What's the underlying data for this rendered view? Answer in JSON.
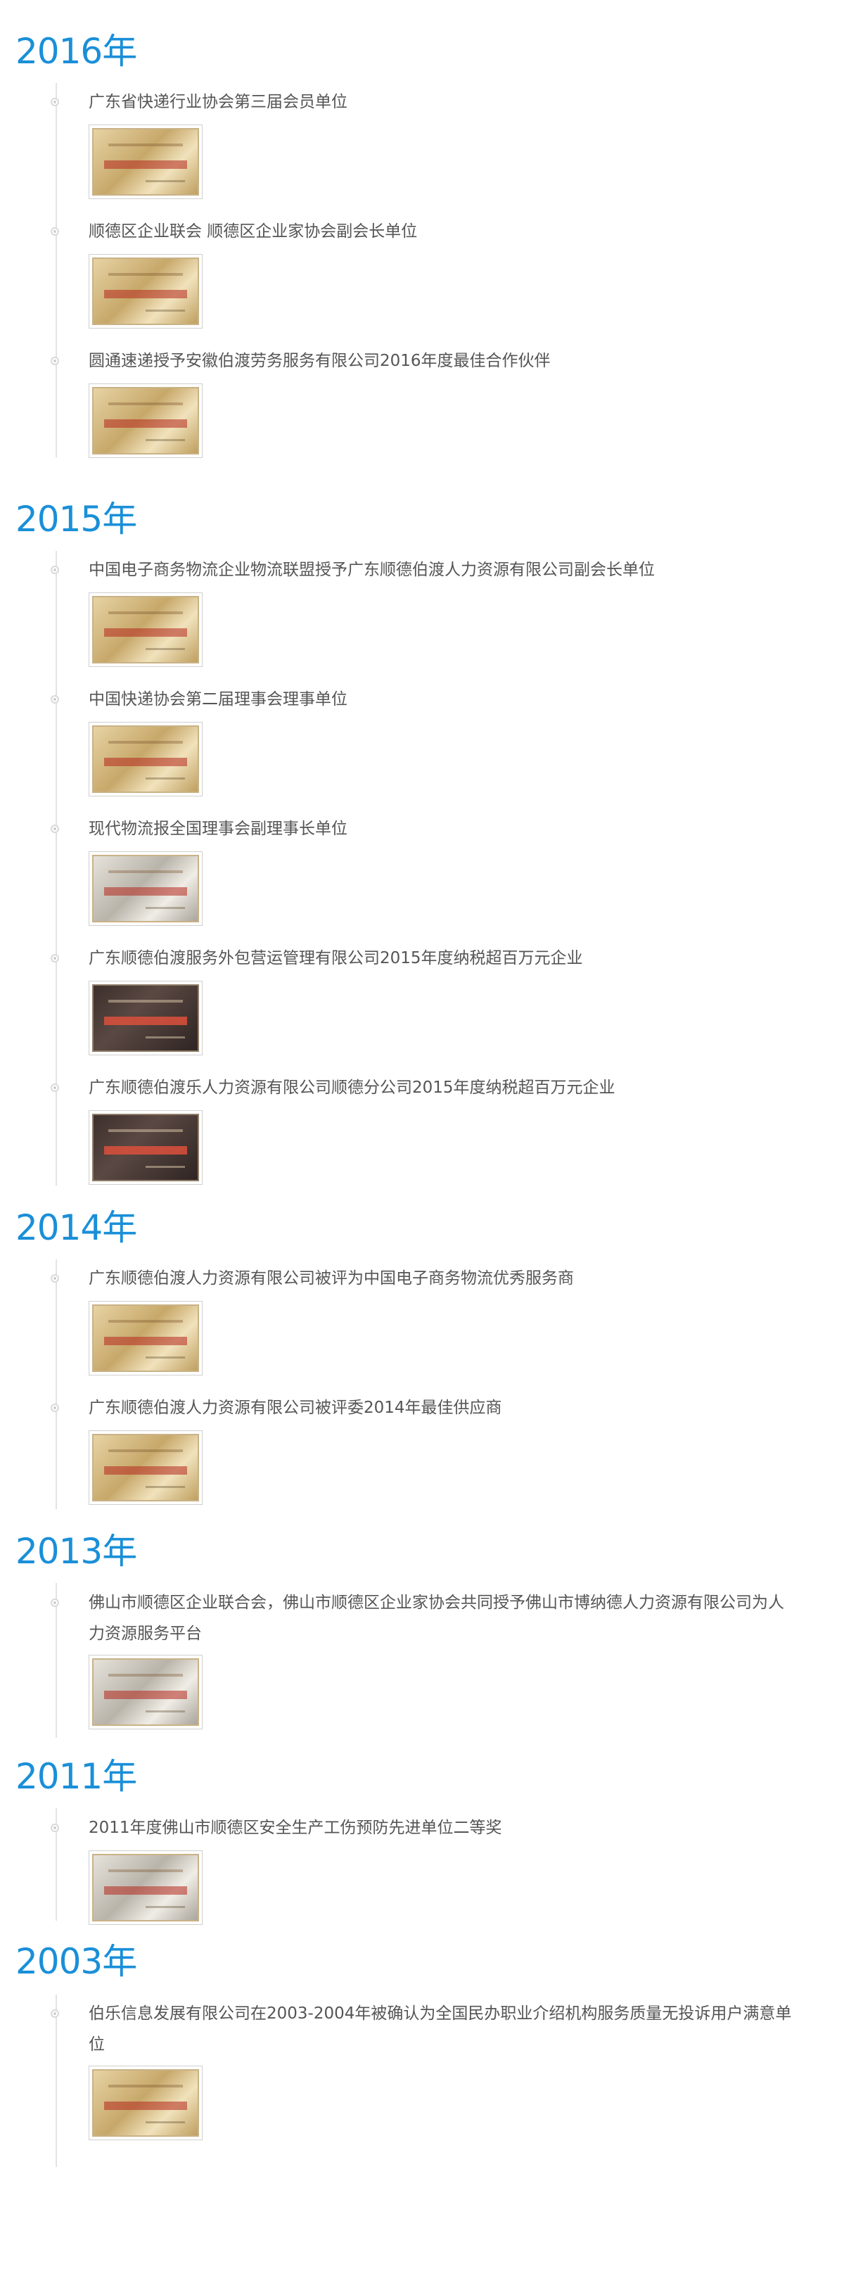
{
  "timeline": [
    {
      "year": "2016年",
      "items": [
        {
          "title": "广东省快递行业协会第三届会员单位",
          "image": "certificate-image",
          "style": "gold"
        },
        {
          "title": "顺德区企业联会  顺德区企业家协会副会长单位",
          "image": "certificate-image",
          "style": "gold"
        },
        {
          "title": "圆通速递授予安徽伯渡劳务服务有限公司2016年度最佳合作伙伴",
          "image": "certificate-image",
          "style": "gold"
        }
      ]
    },
    {
      "year": "2015年",
      "items": [
        {
          "title": "中国电子商务物流企业物流联盟授予广东顺德伯渡人力资源有限公司副会长单位",
          "image": "certificate-image",
          "style": "gold"
        },
        {
          "title": "中国快递协会第二届理事会理事单位",
          "image": "certificate-image",
          "style": "gold"
        },
        {
          "title": "现代物流报全国理事会副理事长单位",
          "image": "certificate-image",
          "style": "silver"
        },
        {
          "title": "广东顺德伯渡服务外包营运管理有限公司2015年度纳税超百万元企业",
          "image": "certificate-image",
          "style": "dark"
        },
        {
          "title": "广东顺德伯渡乐人力资源有限公司顺德分公司2015年度纳税超百万元企业",
          "image": "certificate-image",
          "style": "dark"
        }
      ]
    },
    {
      "year": "2014年",
      "items": [
        {
          "title": "广东顺德伯渡人力资源有限公司被评为中国电子商务物流优秀服务商",
          "image": "certificate-image",
          "style": "gold"
        },
        {
          "title": "广东顺德伯渡人力资源有限公司被评委2014年最佳供应商",
          "image": "certificate-image",
          "style": "gold"
        }
      ]
    },
    {
      "year": "2013年",
      "items": [
        {
          "title": "佛山市顺德区企业联合会，佛山市顺德区企业家协会共同授予佛山市博纳德人力资源有限公司为人力资源服务平台",
          "image": "certificate-image",
          "style": "silver"
        }
      ]
    },
    {
      "year": "2011年",
      "items": [
        {
          "title": "2011年度佛山市顺德区安全生产工伤预防先进单位二等奖",
          "image": "certificate-image",
          "style": "silver"
        }
      ]
    },
    {
      "year": "2003年",
      "items": [
        {
          "title": "伯乐信息发展有限公司在2003-2004年被确认为全国民办职业介绍机构服务质量无投诉用户满意单位",
          "image": "certificate-image",
          "style": "gold"
        }
      ]
    }
  ]
}
